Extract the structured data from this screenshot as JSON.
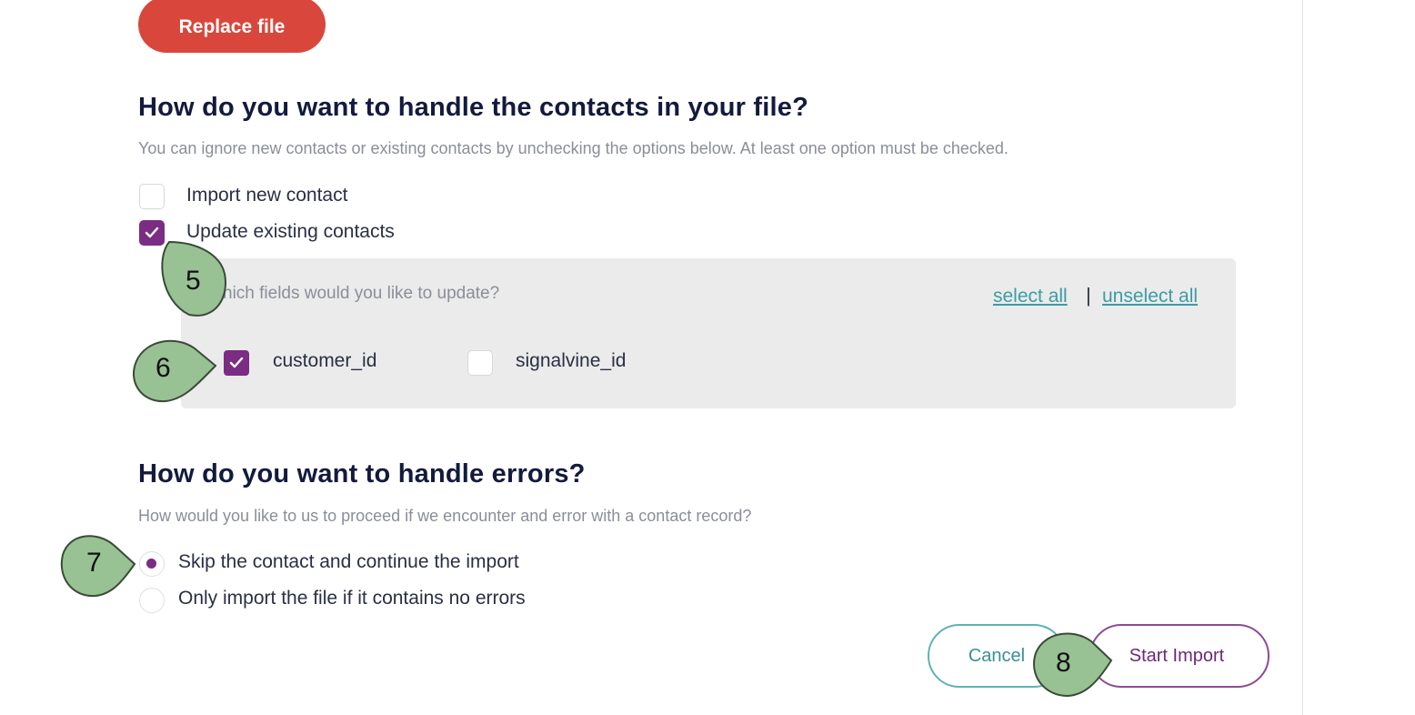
{
  "replace_button": {
    "label": "Replace file"
  },
  "contacts_section": {
    "title": "How do you want to handle the contacts in your file?",
    "description": "You can ignore new contacts or existing contacts by unchecking the options below. At least one option must be checked.",
    "options": [
      {
        "label": "Import new contact",
        "checked": false
      },
      {
        "label": "Update existing contacts",
        "checked": true
      }
    ]
  },
  "fields_panel": {
    "question": "hich fields would you like to update?",
    "select_all": "select all",
    "separator": "|",
    "unselect_all": "unselect all",
    "fields": [
      {
        "label": "customer_id",
        "checked": true
      },
      {
        "label": "signalvine_id",
        "checked": false
      }
    ]
  },
  "errors_section": {
    "title": "How do you want to handle errors?",
    "description": "How would you like to us to proceed if we encounter and error with a contact record?",
    "options": [
      {
        "label": "Skip the contact and continue the import",
        "selected": true
      },
      {
        "label": "Only import the file if it contains no errors",
        "selected": false
      }
    ]
  },
  "footer": {
    "cancel_label": "Cancel",
    "start_label": "Start Import"
  },
  "callouts": [
    "5",
    "6",
    "7",
    "8"
  ],
  "colors": {
    "accent_purple": "#7b2d83",
    "danger_red": "#d9473c",
    "teal": "#3a9da6",
    "callout_green": "#98c294"
  }
}
